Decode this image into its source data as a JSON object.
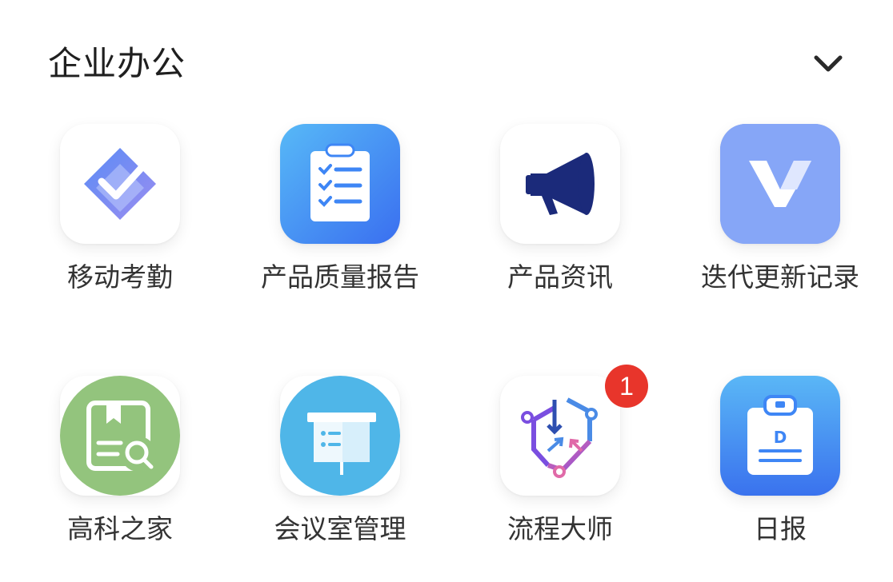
{
  "section": {
    "title": "企业办公",
    "toggle_icon": "chevron-down-icon"
  },
  "apps": [
    {
      "label": "移动考勤",
      "icon": "attendance-check-icon"
    },
    {
      "label": "产品质量报告",
      "icon": "clipboard-checklist-icon"
    },
    {
      "label": "产品资讯",
      "icon": "megaphone-icon"
    },
    {
      "label": "迭代更新记录",
      "icon": "v-logo-icon"
    },
    {
      "label": "高科之家",
      "icon": "book-search-icon"
    },
    {
      "label": "会议室管理",
      "icon": "presentation-board-icon"
    },
    {
      "label": "流程大师",
      "icon": "workflow-cube-icon",
      "badge": "1"
    },
    {
      "label": "日报",
      "icon": "daily-report-clipboard-icon"
    }
  ],
  "colors": {
    "badge": "#e8352b",
    "attendance_blue": "#6f8df7",
    "clipboard_blue": "#3e86f5",
    "megaphone_navy": "#1b2a7a",
    "v_logo_bg": "#86a6f7",
    "book_green": "#93c47d",
    "meeting_blue": "#4fb6e8"
  }
}
